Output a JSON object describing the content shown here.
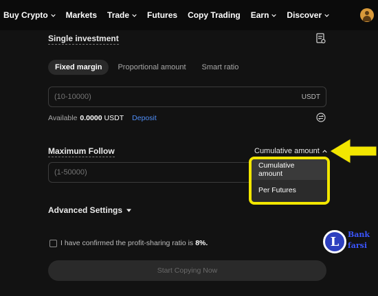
{
  "nav": {
    "items": [
      {
        "label": "Buy Crypto",
        "dropdown": true
      },
      {
        "label": "Markets",
        "dropdown": false
      },
      {
        "label": "Trade",
        "dropdown": true
      },
      {
        "label": "Futures",
        "dropdown": false
      },
      {
        "label": "Copy Trading",
        "dropdown": false
      },
      {
        "label": "Earn",
        "dropdown": true
      },
      {
        "label": "Discover",
        "dropdown": true
      }
    ],
    "avatar_icon": "user-avatar-icon"
  },
  "single_investment": {
    "title": "Single investment",
    "tabs": [
      "Fixed margin",
      "Proportional amount",
      "Smart ratio"
    ],
    "active_tab": "Fixed margin",
    "input_placeholder": "(10-10000)",
    "unit": "USDT",
    "available_label": "Available",
    "available_value": "0.0000",
    "available_unit": "USDT",
    "deposit_label": "Deposit"
  },
  "maximum_follow": {
    "title": "Maximum Follow",
    "mode_label": "Cumulative amount",
    "input_placeholder": "(1-50000)",
    "dropdown_options": [
      "Cumulative amount",
      "Per Futures"
    ]
  },
  "advanced_settings": {
    "label": "Advanced Settings"
  },
  "confirm": {
    "text": "I have confirmed the profit-sharing ratio is",
    "ratio": "8%."
  },
  "cta": {
    "label": "Start Copying Now"
  },
  "watermark": {
    "line1": "Bank",
    "line2": "farsi",
    "letter": "L"
  },
  "colors": {
    "accent_blue": "#4f8ef7",
    "highlight_yellow": "#f2e600",
    "background": "#121212"
  }
}
